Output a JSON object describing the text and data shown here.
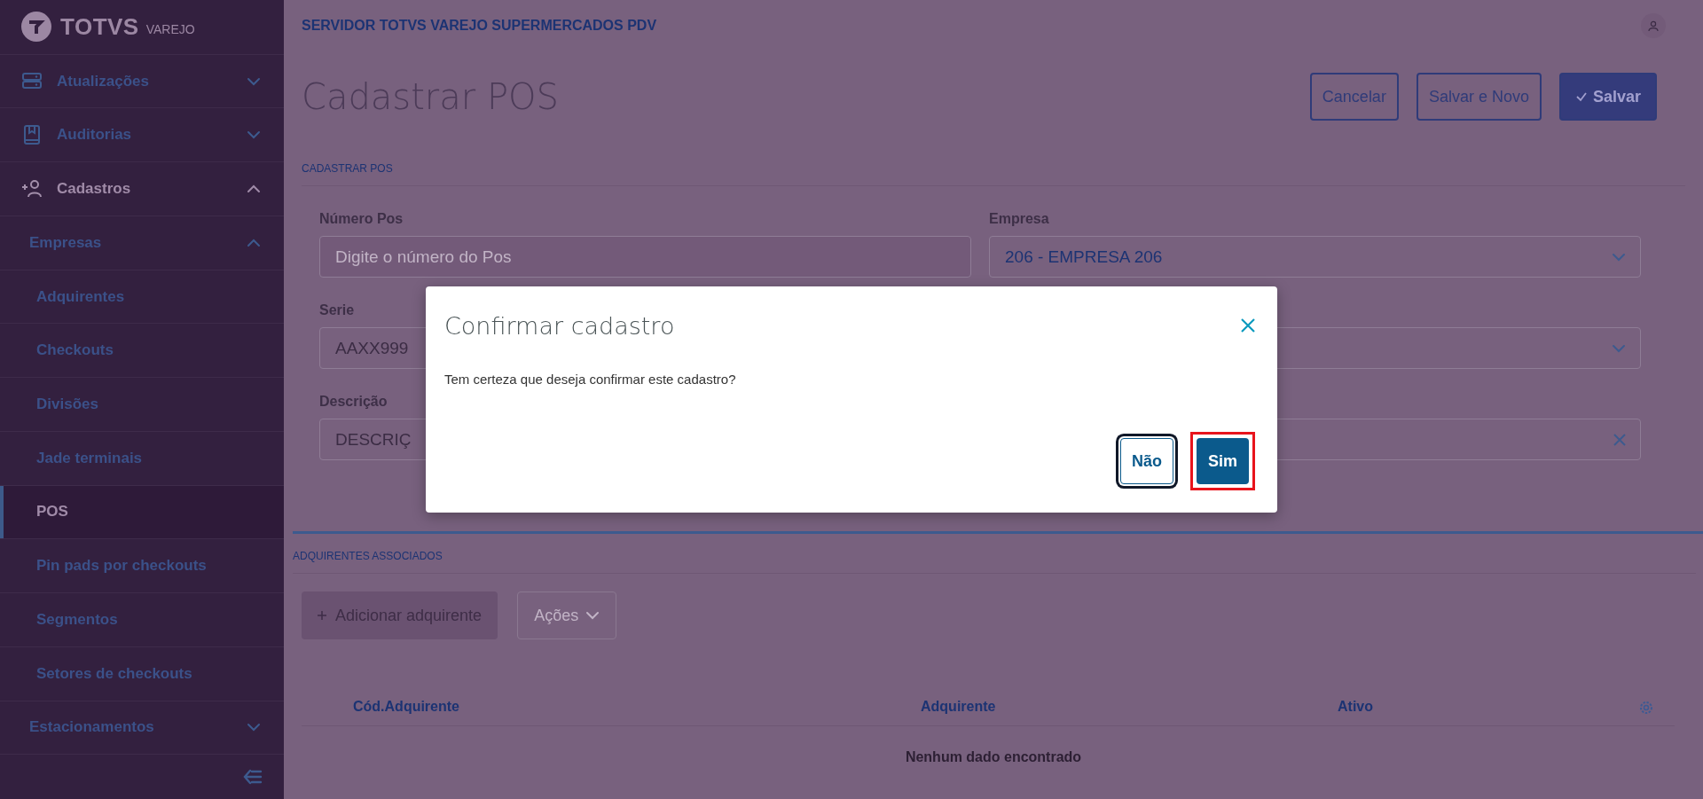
{
  "sidebar": {
    "logo": {
      "brand": "TOTVS",
      "product": "VAREJO"
    },
    "items": [
      {
        "label": "Atualizações",
        "expanded": false
      },
      {
        "label": "Auditorias",
        "expanded": false
      },
      {
        "label": "Cadastros",
        "expanded": true,
        "children": [
          {
            "label": "Empresas",
            "expanded": true,
            "children": [
              {
                "label": "Adquirentes",
                "selected": false
              },
              {
                "label": "Checkouts",
                "selected": false
              },
              {
                "label": "Divisões",
                "selected": false
              },
              {
                "label": "Jade terminais",
                "selected": false
              },
              {
                "label": "POS",
                "selected": true
              },
              {
                "label": "Pin pads por checkouts",
                "selected": false
              },
              {
                "label": "Segmentos",
                "selected": false
              },
              {
                "label": "Setores de checkouts",
                "selected": false
              }
            ]
          },
          {
            "label": "Estacionamentos",
            "expanded": false
          }
        ]
      }
    ]
  },
  "header": {
    "server_name": "SERVIDOR TOTVS VAREJO SUPERMERCADOS PDV",
    "page_title": "Cadastrar POS",
    "actions": [
      {
        "label": "Cancelar",
        "kind": "outline"
      },
      {
        "label": "Salvar e Novo",
        "kind": "outline"
      },
      {
        "label": "Salvar",
        "kind": "primary"
      }
    ]
  },
  "form": {
    "section": "CADASTRAR POS",
    "fields": [
      {
        "label": "Número Pos",
        "placeholder": "Digite o número do Pos",
        "kind": "text"
      },
      {
        "label": "Empresa",
        "value": "206 - EMPRESA 206",
        "kind": "select"
      },
      {
        "label": "Serie",
        "value": "AAXX999",
        "kind": "text"
      },
      {
        "kind": "select"
      },
      {
        "label": "Descrição",
        "value": "DESCRIÇ",
        "kind": "text"
      },
      {
        "kind": "clearable"
      }
    ]
  },
  "acquirers": {
    "title": "ADQUIRENTES ASSOCIADOS",
    "add_button": "Adicionar adquirente",
    "actions_button": {
      "label": "Ações",
      "disabled": true
    },
    "columns": [
      "Cód.Adquirente",
      "Adquirente",
      "Ativo"
    ],
    "empty_message": "Nenhum dado encontrado"
  },
  "dialog": {
    "title": "Confirmar cadastro",
    "message": "Tem certeza que deseja confirmar este cadastro?",
    "buttons": [
      {
        "label": "Não",
        "kind": "secondary",
        "focused": true,
        "highlighted": false
      },
      {
        "label": "Sim",
        "kind": "primary",
        "focused": false,
        "highlighted": true
      }
    ]
  }
}
